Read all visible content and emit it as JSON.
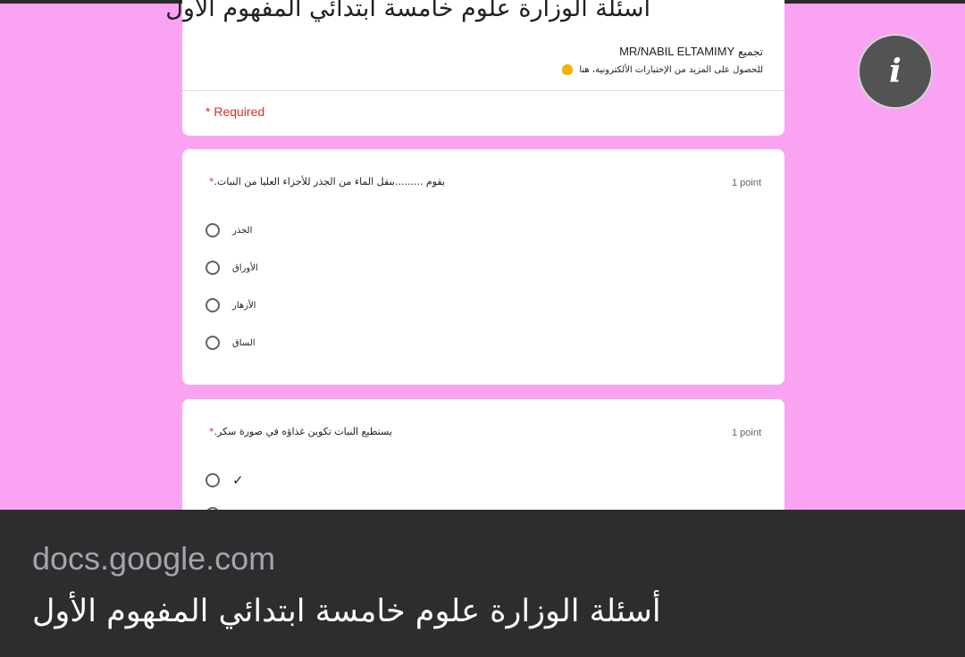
{
  "form": {
    "title": "أسئلة الوزارة علوم خامسة ابتدائي المفهوم الأول",
    "collector_prefix": "تجميع",
    "collector_name": "MR/NABIL ELTAMIMY",
    "more_info": "للحصول على المزيد من الإختبارات الألكترونية، هنا",
    "required_label": "* Required"
  },
  "questions": [
    {
      "text": "يقوم .........بنقل الماء من الجذر للأجزاء العليا من النبات.",
      "required_mark": "*",
      "points": "1 point",
      "options": [
        "الجذر",
        "الأوراق",
        "الأزهار",
        "الساق"
      ]
    },
    {
      "text": "يستطيع النبات تكوين غذاؤه في صورة سكر.",
      "required_mark": "*",
      "points": "1 point",
      "options": [
        "✓"
      ]
    }
  ],
  "info_button": {
    "icon": "info-icon",
    "glyph": "i"
  },
  "link_preview": {
    "domain": "docs.google.com",
    "title": "أسئلة الوزارة علوم خامسة ابتدائي المفهوم الأول"
  },
  "colors": {
    "background": "#f9a3f2",
    "required": "#d93025",
    "preview_bar": "#2c2d2f"
  }
}
